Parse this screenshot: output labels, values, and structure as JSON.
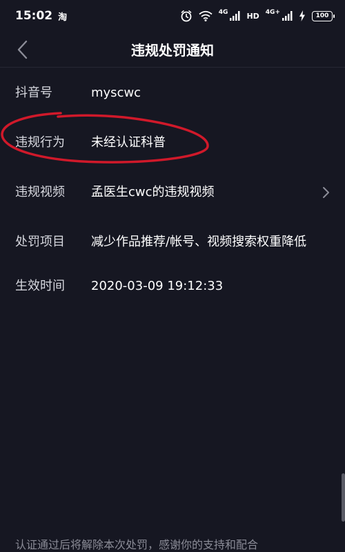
{
  "status_bar": {
    "time": "15:02",
    "app_icon": "淘",
    "network_1": "4G",
    "hd": "HD",
    "network_2": "4G+",
    "battery": "100"
  },
  "header": {
    "title": "违规处罚通知"
  },
  "rows": {
    "username": {
      "label": "抖音号",
      "value": "myscwc"
    },
    "behavior": {
      "label": "违规行为",
      "value": "未经认证科普"
    },
    "video": {
      "label": "违规视频",
      "value": "孟医生cwc的违规视频"
    },
    "penalty": {
      "label": "处罚项目",
      "value": "减少作品推荐/帐号、视频搜索权重降低"
    },
    "time": {
      "label": "生效时间",
      "value": "2020-03-09 19:12:33"
    }
  },
  "footer": {
    "note": "认证通过后将解除本次处罚，感谢你的支持和配合"
  },
  "colors": {
    "background": "#161722",
    "annotation": "#d0192a",
    "text": "#ffffff",
    "label": "#d7d8df",
    "muted": "#8a8b96"
  },
  "icons": [
    "alarm-icon",
    "wifi-icon",
    "signal-icon",
    "charging-icon",
    "battery-icon",
    "back-arrow-icon",
    "chevron-right-icon"
  ]
}
